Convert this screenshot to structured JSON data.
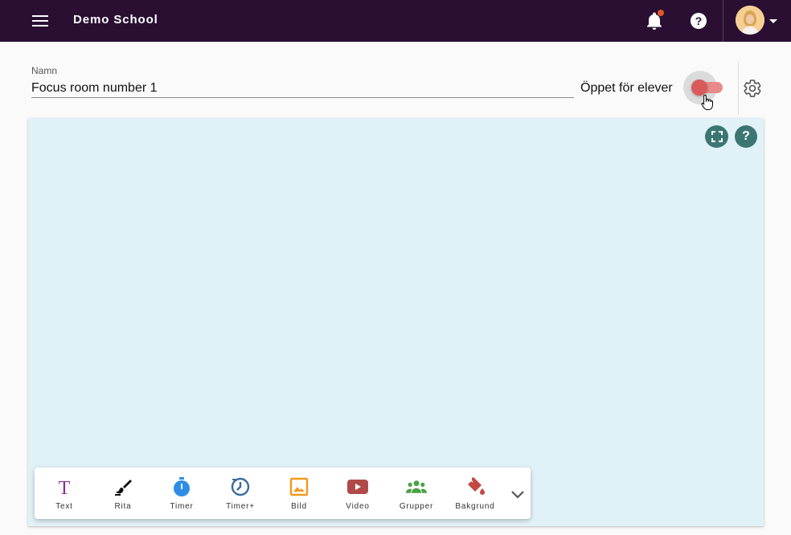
{
  "header": {
    "school_name": "Demo School",
    "has_notification": true
  },
  "room": {
    "name_label": "Namn",
    "name_value": "Focus room number 1",
    "open_label": "Öppet för elever",
    "open_toggle_on": true
  },
  "canvas": {
    "background_color": "#e1f1f8",
    "help_glyph": "?"
  },
  "toolbar": {
    "tools": [
      {
        "label": "Text",
        "icon": "text-icon",
        "color": "#8e2a9c"
      },
      {
        "label": "Rita",
        "icon": "brush-icon",
        "color": "#111111"
      },
      {
        "label": "Timer",
        "icon": "stopwatch-icon",
        "color": "#2e8de4"
      },
      {
        "label": "Timer+",
        "icon": "timer-plus-icon",
        "color": "#3a6b96"
      },
      {
        "label": "Bild",
        "icon": "image-icon",
        "color": "#f09a1c"
      },
      {
        "label": "Video",
        "icon": "video-icon",
        "color": "#b04a4a"
      },
      {
        "label": "Grupper",
        "icon": "groups-icon",
        "color": "#4aa043"
      },
      {
        "label": "Bakgrund",
        "icon": "paint-bucket-icon",
        "color": "#c34a44"
      }
    ]
  },
  "colors": {
    "topbar": "#2a0f33",
    "accent_teal": "#3c7673",
    "toggle_red": "#d95a5a"
  }
}
